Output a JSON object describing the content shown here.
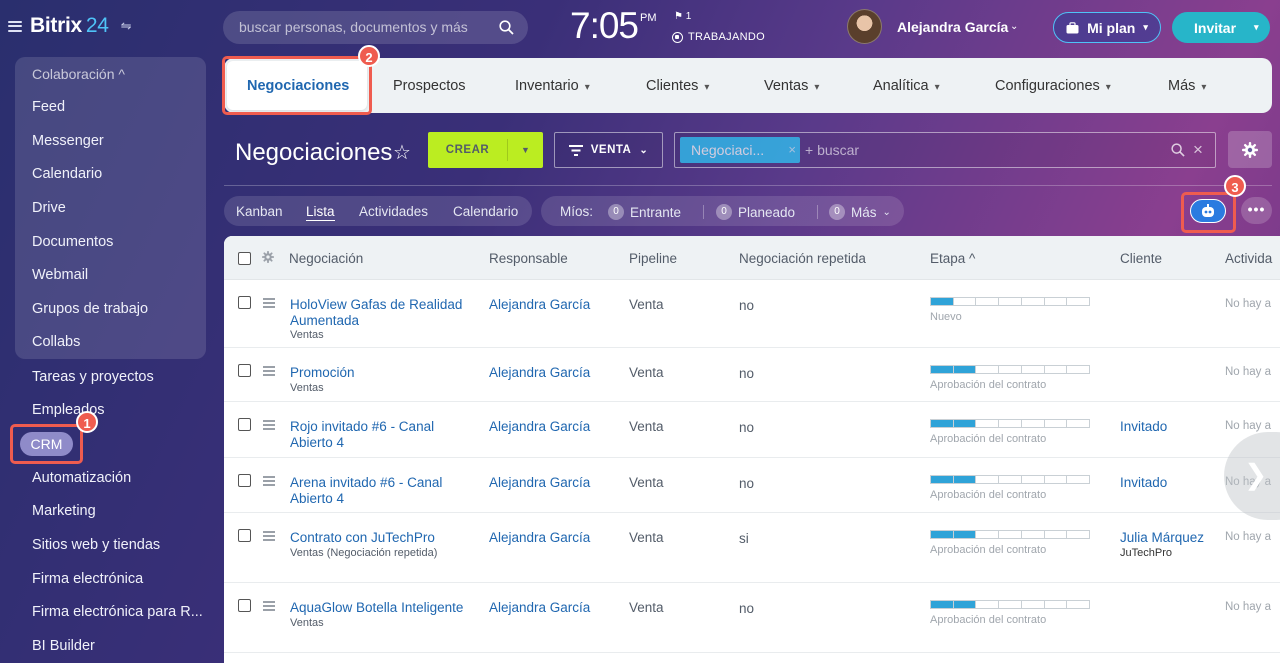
{
  "app": {
    "logo": "Bitrix",
    "logo_num": "24"
  },
  "sidebar": {
    "group_label": "Colaboración ^",
    "group_items": [
      "Feed",
      "Messenger",
      "Calendario",
      "Drive",
      "Documentos",
      "Webmail",
      "Grupos de trabajo",
      "Collabs"
    ],
    "items": [
      "Tareas y proyectos",
      "Empleados",
      "CRM",
      "Automatización",
      "Marketing",
      "Sitios web y tiendas",
      "Firma electrónica",
      "Firma electrónica para R...",
      "BI Builder"
    ]
  },
  "topbar": {
    "search_placeholder": "buscar personas, documentos y más",
    "time": "7:05",
    "ampm": "PM",
    "flag": "1",
    "status": "TRABAJANDO",
    "user": "Alejandra García",
    "plan": "Mi plan",
    "invite": "Invitar"
  },
  "tabs": [
    "Negociaciones",
    "Prospectos",
    "Inventario",
    "Clientes",
    "Ventas",
    "Analítica",
    "Configuraciones",
    "Más"
  ],
  "toolbar": {
    "title": "Negociaciones",
    "create": "CREAR",
    "pipeline": "VENTA",
    "filter_tag": "Negociaci...",
    "filter_placeholder": "+ buscar"
  },
  "views": [
    "Kanban",
    "Lista",
    "Actividades",
    "Calendario"
  ],
  "counters": {
    "label": "Míos:",
    "items": [
      {
        "n": "0",
        "label": "Entrante"
      },
      {
        "n": "0",
        "label": "Planeado"
      },
      {
        "n": "0",
        "label": "Más"
      }
    ]
  },
  "badges": [
    "1",
    "2",
    "3"
  ],
  "grid": {
    "columns": [
      "Negociación",
      "Responsable",
      "Pipeline",
      "Negociación repetida",
      "Etapa ^",
      "Cliente",
      "Activida"
    ],
    "rows": [
      {
        "deal": "HoloView Gafas de Realidad Aumentada",
        "sub": "Ventas",
        "owner": "Alejandra García",
        "pipeline": "Venta",
        "repeat": "no",
        "stage": "Nuevo",
        "stage_progress": 1,
        "client": "",
        "client_sub": "",
        "activity": "No hay a"
      },
      {
        "deal": "Promoción",
        "sub": "Ventas",
        "owner": "Alejandra García",
        "pipeline": "Venta",
        "repeat": "no",
        "stage": "Aprobación del contrato",
        "stage_progress": 2,
        "client": "",
        "client_sub": "",
        "activity": "No hay a"
      },
      {
        "deal": "Rojo invitado #6 - Canal Abierto 4",
        "sub": "",
        "owner": "Alejandra García",
        "pipeline": "Venta",
        "repeat": "no",
        "stage": "Aprobación del contrato",
        "stage_progress": 2,
        "client": "Invitado",
        "client_sub": "",
        "activity": "No hay a"
      },
      {
        "deal": "Arena invitado #6 - Canal Abierto 4",
        "sub": "",
        "owner": "Alejandra García",
        "pipeline": "Venta",
        "repeat": "no",
        "stage": "Aprobación del contrato",
        "stage_progress": 2,
        "client": "Invitado",
        "client_sub": "",
        "activity": "No hay a"
      },
      {
        "deal": "Contrato con JuTechPro",
        "sub": "Ventas (Negociación repetida)",
        "owner": "Alejandra García",
        "pipeline": "Venta",
        "repeat": "si",
        "stage": "Aprobación del contrato",
        "stage_progress": 2,
        "client": "Julia Márquez",
        "client_sub": "JuTechPro",
        "activity": "No hay a"
      },
      {
        "deal": "AquaGlow Botella Inteligente",
        "sub": "Ventas",
        "owner": "Alejandra García",
        "pipeline": "Venta",
        "repeat": "no",
        "stage": "Aprobación del contrato",
        "stage_progress": 2,
        "client": "",
        "client_sub": "",
        "activity": "No hay a"
      }
    ]
  }
}
